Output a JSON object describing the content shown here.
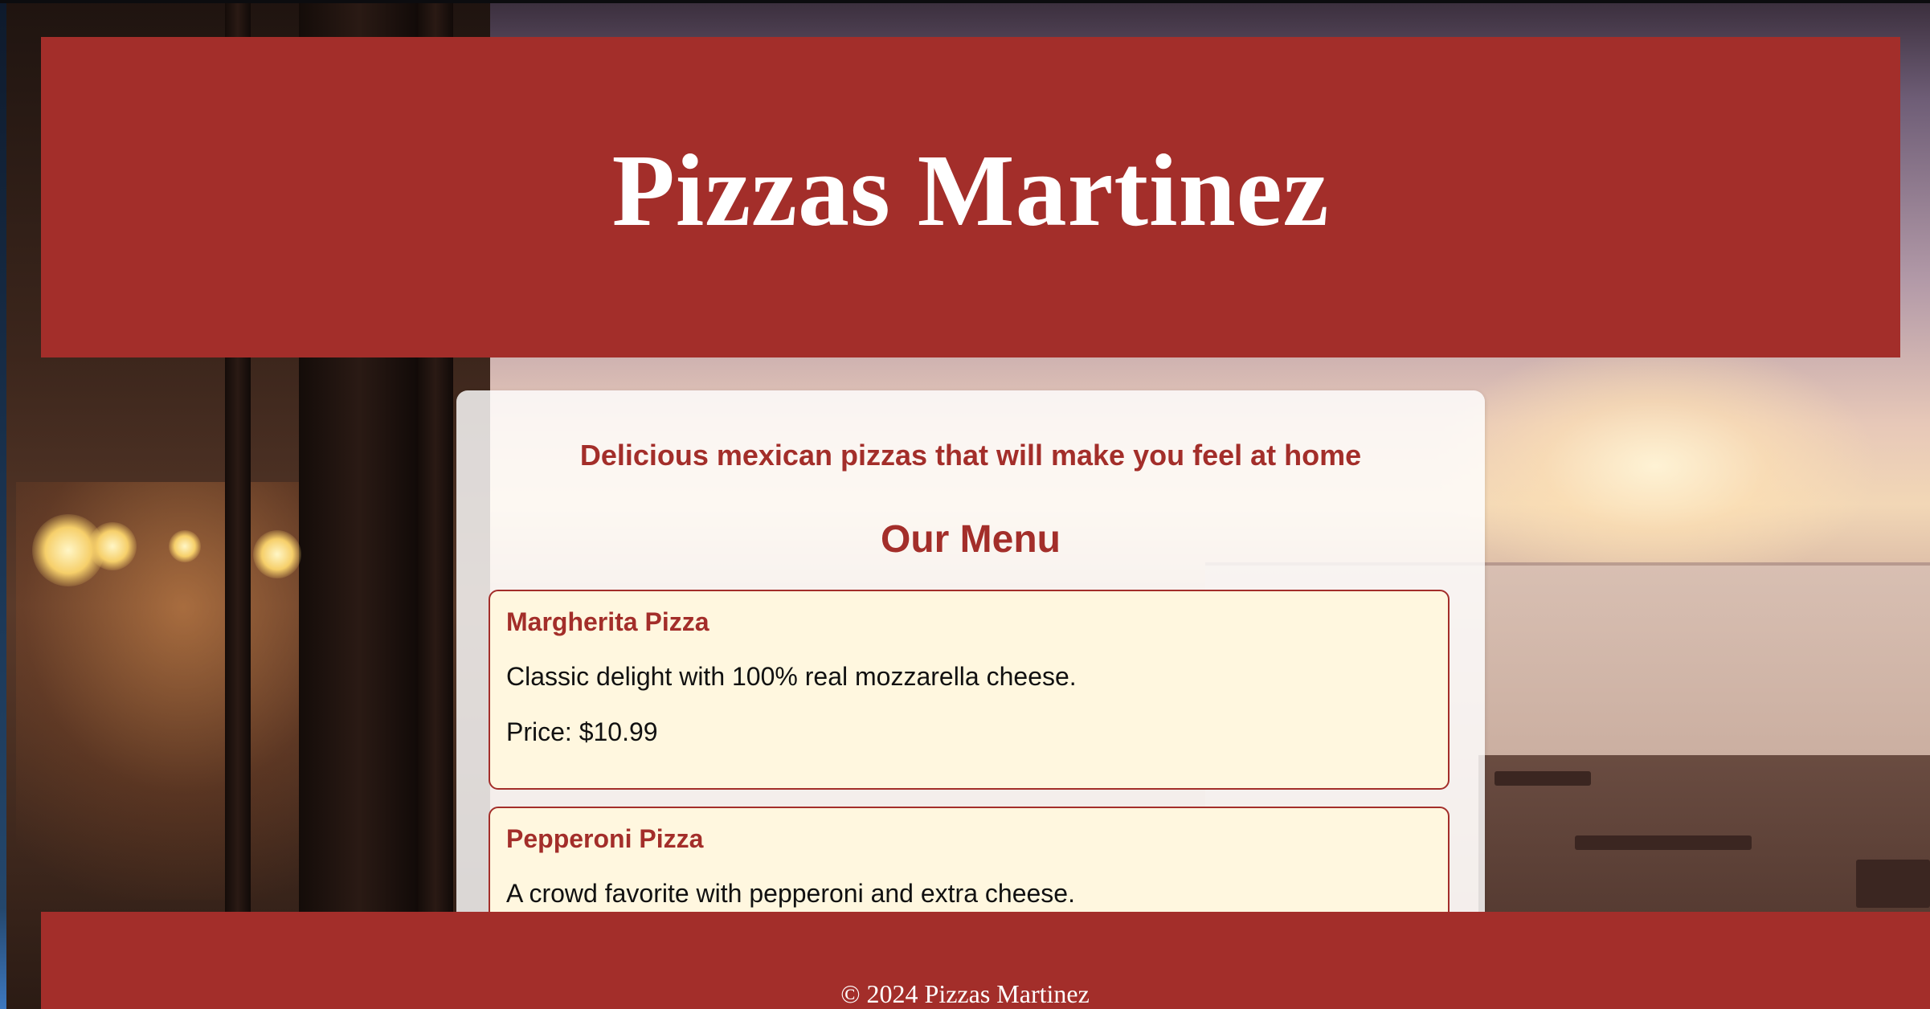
{
  "header": {
    "title": "Pizzas Martinez"
  },
  "main": {
    "tagline": "Delicious mexican pizzas that will make you feel at home",
    "menu_heading": "Our Menu",
    "items": [
      {
        "name": "Margherita Pizza",
        "description": "Classic delight with 100% real mozzarella cheese.",
        "price": "Price: $10.99"
      },
      {
        "name": "Pepperoni Pizza",
        "description": "A crowd favorite with pepperoni and extra cheese."
      }
    ]
  },
  "footer": {
    "copyright": "© 2024 Pizzas Martinez"
  },
  "colors": {
    "brand_red": "#a32e2a",
    "card_background": "#fff7df",
    "header_text": "#ffffff"
  },
  "background": {
    "icon": "restaurant-terrace-sunset-photo"
  }
}
